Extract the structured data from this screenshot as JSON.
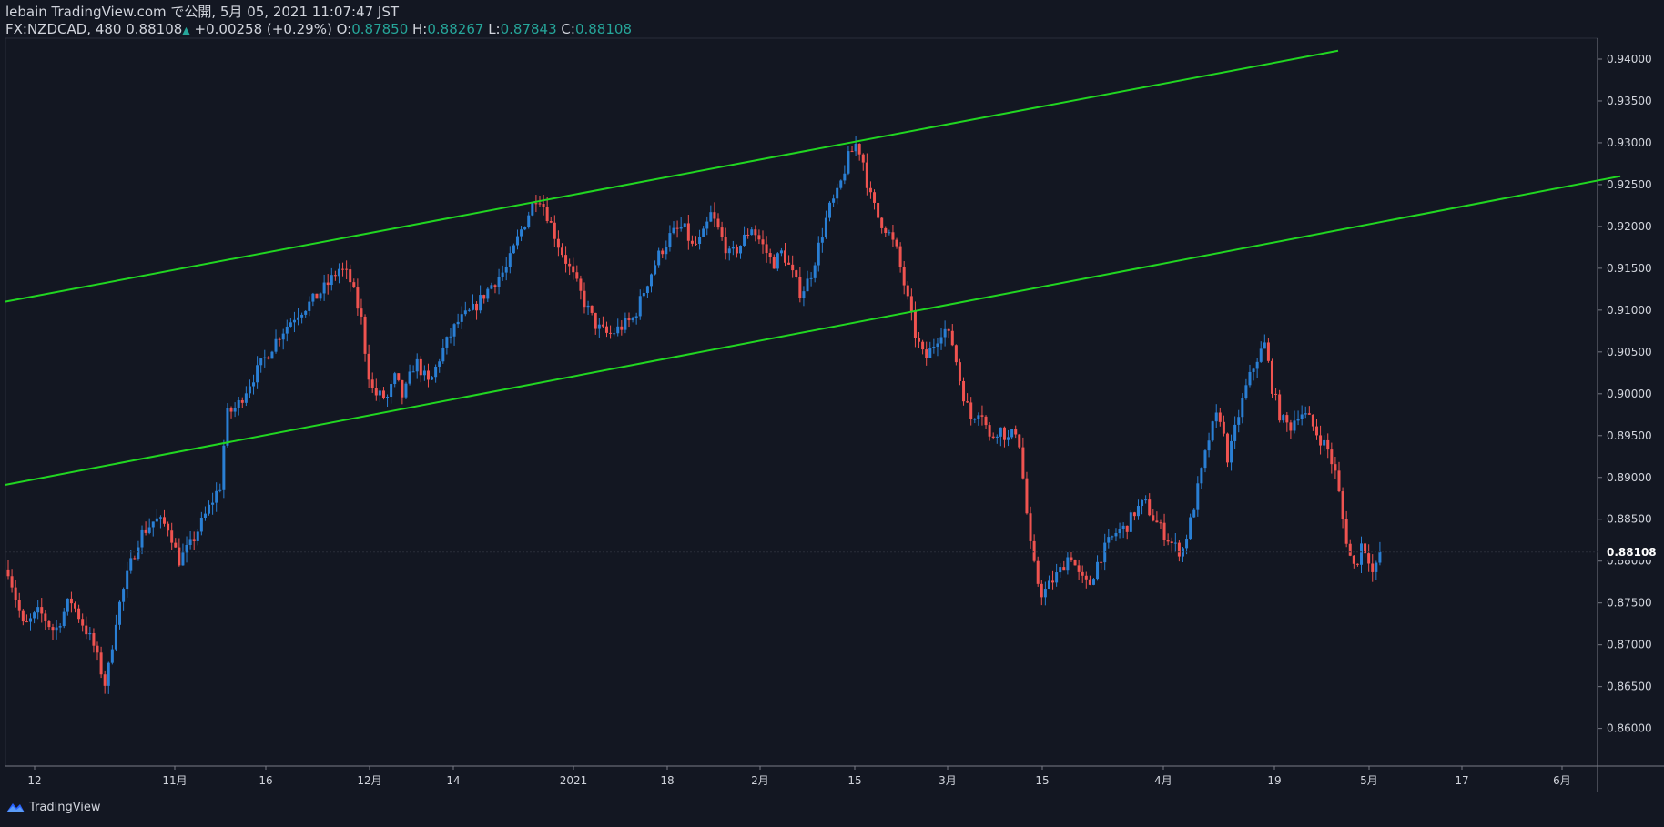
{
  "header": {
    "publisher": "lebain TradingView.com で公開, 5月 05, 2021 11:07:47 JST",
    "symbol": "FX:NZDCAD, 480",
    "last": "0.88108",
    "change": "+0.00258 (+0.29%)",
    "o_label": "O:",
    "o_value": "0.87850",
    "h_label": "H:",
    "h_value": "0.88267",
    "l_label": "L:",
    "l_value": "0.87843",
    "c_label": "C:",
    "c_value": "0.88108"
  },
  "footer": {
    "brand": "TradingView"
  },
  "colors": {
    "background": "#131722",
    "up": "#2a7fd4",
    "down": "#ef5350",
    "trendline": "#21d621",
    "text": "#d1d4dc",
    "positive": "#26a69a"
  },
  "chart_data": {
    "type": "candlestick",
    "ylim": [
      0.8555,
      0.9425
    ],
    "y_ticks": [
      "0.86000",
      "0.86500",
      "0.87000",
      "0.87500",
      "0.88000",
      "0.88500",
      "0.89000",
      "0.89500",
      "0.90000",
      "0.90500",
      "0.91000",
      "0.91500",
      "0.92000",
      "0.92500",
      "0.93000",
      "0.93500",
      "0.94000"
    ],
    "x_ticks": [
      "12",
      "11月",
      "16",
      "12月",
      "14",
      "2021",
      "18",
      "2月",
      "15",
      "3月",
      "15",
      "4月",
      "19",
      "5月",
      "17",
      "6月"
    ],
    "current_price": "0.88108",
    "bar_count": 370,
    "close_path": [
      [
        0,
        0.879
      ],
      [
        10,
        0.872
      ],
      [
        20,
        0.874
      ],
      [
        30,
        0.8715
      ],
      [
        40,
        0.8755
      ],
      [
        55,
        0.87
      ],
      [
        63,
        0.865
      ],
      [
        70,
        0.8735
      ],
      [
        78,
        0.879
      ],
      [
        85,
        0.883
      ],
      [
        95,
        0.885
      ],
      [
        104,
        0.884
      ],
      [
        110,
        0.88
      ],
      [
        118,
        0.882
      ],
      [
        126,
        0.885
      ],
      [
        134,
        0.888
      ],
      [
        137,
        0.889
      ],
      [
        141,
        0.8975
      ],
      [
        148,
        0.8985
      ],
      [
        155,
        0.901
      ],
      [
        165,
        0.904
      ],
      [
        175,
        0.907
      ],
      [
        186,
        0.9095
      ],
      [
        196,
        0.911
      ],
      [
        206,
        0.913
      ],
      [
        214,
        0.915
      ],
      [
        220,
        0.914
      ],
      [
        228,
        0.909
      ],
      [
        232,
        0.903
      ],
      [
        236,
        0.9
      ],
      [
        245,
        0.8995
      ],
      [
        250,
        0.902
      ],
      [
        255,
        0.8995
      ],
      [
        263,
        0.904
      ],
      [
        272,
        0.901
      ],
      [
        280,
        0.905
      ],
      [
        290,
        0.9085
      ],
      [
        300,
        0.91
      ],
      [
        312,
        0.913
      ],
      [
        322,
        0.915
      ],
      [
        330,
        0.919
      ],
      [
        336,
        0.9215
      ],
      [
        342,
        0.924
      ],
      [
        348,
        0.9215
      ],
      [
        355,
        0.918
      ],
      [
        365,
        0.914
      ],
      [
        372,
        0.911
      ],
      [
        380,
        0.908
      ],
      [
        388,
        0.907
      ],
      [
        396,
        0.908
      ],
      [
        404,
        0.909
      ],
      [
        412,
        0.913
      ],
      [
        420,
        0.9165
      ],
      [
        428,
        0.919
      ],
      [
        436,
        0.92
      ],
      [
        442,
        0.9175
      ],
      [
        448,
        0.9185
      ],
      [
        454,
        0.9215
      ],
      [
        460,
        0.919
      ],
      [
        466,
        0.9165
      ],
      [
        472,
        0.9175
      ],
      [
        480,
        0.92
      ],
      [
        488,
        0.9175
      ],
      [
        494,
        0.9155
      ],
      [
        500,
        0.917
      ],
      [
        506,
        0.9145
      ],
      [
        512,
        0.912
      ],
      [
        518,
        0.914
      ],
      [
        524,
        0.918
      ],
      [
        530,
        0.922
      ],
      [
        536,
        0.924
      ],
      [
        542,
        0.928
      ],
      [
        548,
        0.93
      ],
      [
        552,
        0.928
      ],
      [
        556,
        0.924
      ],
      [
        562,
        0.921
      ],
      [
        568,
        0.9195
      ],
      [
        574,
        0.917
      ],
      [
        580,
        0.912
      ],
      [
        586,
        0.907
      ],
      [
        592,
        0.904
      ],
      [
        598,
        0.906
      ],
      [
        604,
        0.908
      ],
      [
        610,
        0.906
      ],
      [
        616,
        0.9005
      ],
      [
        622,
        0.897
      ],
      [
        628,
        0.8985
      ],
      [
        634,
        0.8945
      ],
      [
        640,
        0.896
      ],
      [
        646,
        0.8945
      ],
      [
        652,
        0.896
      ],
      [
        656,
        0.889
      ],
      [
        660,
        0.882
      ],
      [
        664,
        0.878
      ],
      [
        668,
        0.876
      ],
      [
        674,
        0.8775
      ],
      [
        680,
        0.879
      ],
      [
        686,
        0.881
      ],
      [
        692,
        0.878
      ],
      [
        698,
        0.877
      ],
      [
        704,
        0.88
      ],
      [
        710,
        0.882
      ],
      [
        716,
        0.8835
      ],
      [
        722,
        0.884
      ],
      [
        728,
        0.886
      ],
      [
        734,
        0.887
      ],
      [
        740,
        0.885
      ],
      [
        746,
        0.8835
      ],
      [
        752,
        0.882
      ],
      [
        758,
        0.881
      ],
      [
        764,
        0.885
      ],
      [
        770,
        0.89
      ],
      [
        776,
        0.895
      ],
      [
        782,
        0.898
      ],
      [
        788,
        0.892
      ],
      [
        794,
        0.897
      ],
      [
        800,
        0.901
      ],
      [
        806,
        0.904
      ],
      [
        812,
        0.906
      ],
      [
        816,
        0.901
      ],
      [
        822,
        0.897
      ],
      [
        828,
        0.896
      ],
      [
        834,
        0.898
      ],
      [
        840,
        0.897
      ],
      [
        846,
        0.895
      ],
      [
        852,
        0.8935
      ],
      [
        858,
        0.89
      ],
      [
        862,
        0.885
      ],
      [
        866,
        0.881
      ],
      [
        870,
        0.879
      ],
      [
        874,
        0.882
      ],
      [
        878,
        0.881
      ],
      [
        882,
        0.878
      ],
      [
        886,
        0.8811
      ]
    ],
    "trendlines": [
      {
        "name": "channel-upper",
        "x1": -0.5,
        "y1": 0.911,
        "x2": 1464,
        "y2": 0.941
      },
      {
        "name": "channel-lower",
        "x1": -0.5,
        "y1": 0.8891,
        "x2": 1774,
        "y2": 0.926
      }
    ]
  }
}
